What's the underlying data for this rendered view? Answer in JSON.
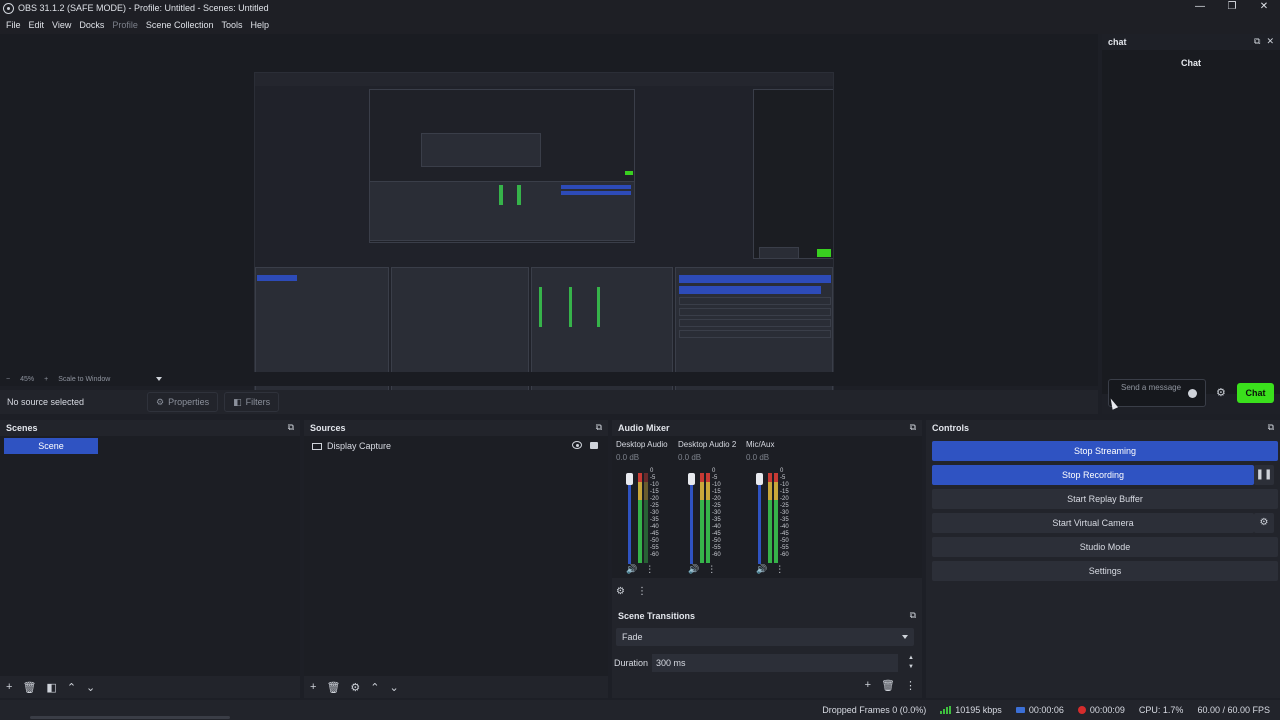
{
  "window": {
    "title": "OBS 31.1.2 (SAFE MODE) - Profile: Untitled - Scenes: Untitled",
    "controls": [
      "—",
      "❐",
      "✕"
    ]
  },
  "menu": [
    "File",
    "Edit",
    "View",
    "Docks",
    "Profile",
    "Scene Collection",
    "Tools",
    "Help"
  ],
  "preview": {
    "zoom": "45%",
    "scale_mode": "Scale to Window"
  },
  "source_toolbar": {
    "selection": "No source selected",
    "properties": "Properties",
    "filters": "Filters"
  },
  "chat": {
    "dock_title": "chat",
    "heading": "Chat",
    "input_placeholder": "Send a message",
    "send_label": "Chat"
  },
  "scenes": {
    "title": "Scenes",
    "items": [
      "Scene"
    ]
  },
  "sources": {
    "title": "Sources",
    "items": [
      "Display Capture"
    ]
  },
  "mixer": {
    "title": "Audio Mixer",
    "channels": [
      {
        "name": "Desktop Audio",
        "db": "0.0 dB"
      },
      {
        "name": "Desktop Audio 2",
        "db": "0.0 dB"
      },
      {
        "name": "Mic/Aux",
        "db": "0.0 dB"
      }
    ],
    "scale": [
      "0",
      "-5",
      "-10",
      "-15",
      "-20",
      "-25",
      "-30",
      "-35",
      "-40",
      "-45",
      "-50",
      "-55",
      "-60"
    ]
  },
  "transitions": {
    "title": "Scene Transitions",
    "selected": "Fade",
    "duration_label": "Duration",
    "duration_value": "300 ms"
  },
  "controls": {
    "title": "Controls",
    "stop_streaming": "Stop Streaming",
    "stop_recording": "Stop Recording",
    "start_replay_buffer": "Start Replay Buffer",
    "start_virtual_camera": "Start Virtual Camera",
    "studio_mode": "Studio Mode",
    "settings": "Settings"
  },
  "status": {
    "dropped_frames": "Dropped Frames 0 (0.0%)",
    "bitrate": "10195 kbps",
    "stream_time": "00:00:06",
    "rec_time": "00:00:09",
    "cpu": "CPU: 1.7%",
    "fps": "60.00 / 60.00 FPS"
  },
  "colors": {
    "accent_blue": "#2f53c2",
    "chat_green": "#3ae01c",
    "record_red": "#d52c2c"
  }
}
